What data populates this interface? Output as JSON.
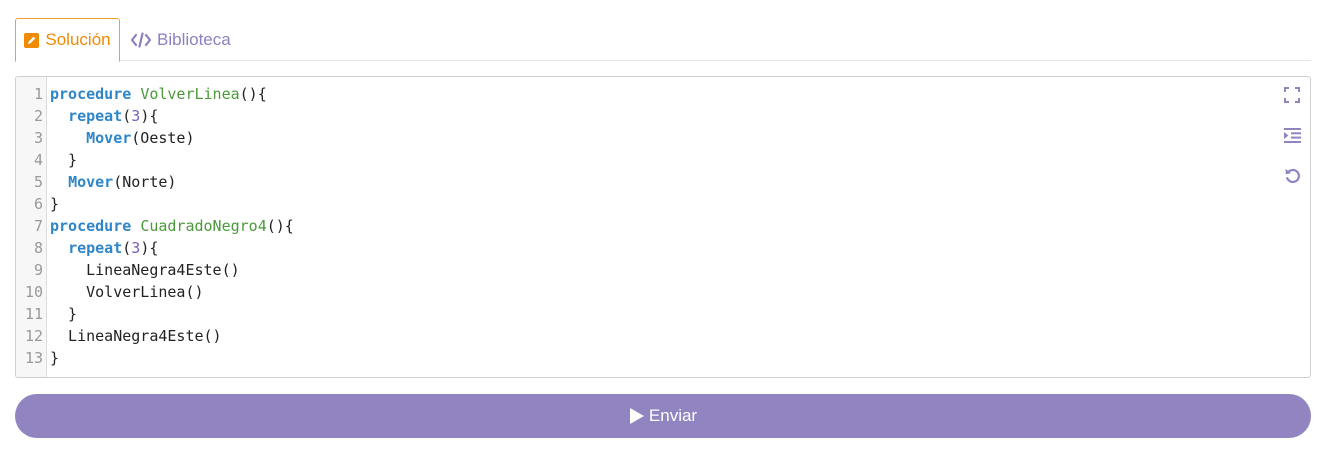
{
  "tabs": {
    "solucion_label": "Solución",
    "biblioteca_label": "Biblioteca"
  },
  "editor": {
    "lines": [
      {
        "n": "1",
        "tokens": [
          [
            "kw",
            "procedure"
          ],
          [
            "t",
            " "
          ],
          [
            "fn",
            "VolverLinea"
          ],
          [
            "t",
            "(){"
          ]
        ]
      },
      {
        "n": "2",
        "tokens": [
          [
            "t",
            "  "
          ],
          [
            "kw",
            "repeat"
          ],
          [
            "t",
            "("
          ],
          [
            "num",
            "3"
          ],
          [
            "t",
            "){"
          ]
        ]
      },
      {
        "n": "3",
        "tokens": [
          [
            "t",
            "    "
          ],
          [
            "kw",
            "Mover"
          ],
          [
            "t",
            "(Oeste)"
          ]
        ]
      },
      {
        "n": "4",
        "tokens": [
          [
            "t",
            "  }"
          ]
        ]
      },
      {
        "n": "5",
        "tokens": [
          [
            "t",
            "  "
          ],
          [
            "kw",
            "Mover"
          ],
          [
            "t",
            "(Norte)"
          ]
        ]
      },
      {
        "n": "6",
        "tokens": [
          [
            "t",
            "}"
          ]
        ]
      },
      {
        "n": "7",
        "tokens": [
          [
            "kw",
            "procedure"
          ],
          [
            "t",
            " "
          ],
          [
            "fn",
            "CuadradoNegro4"
          ],
          [
            "t",
            "(){"
          ]
        ]
      },
      {
        "n": "8",
        "tokens": [
          [
            "t",
            "  "
          ],
          [
            "kw",
            "repeat"
          ],
          [
            "t",
            "("
          ],
          [
            "num",
            "3"
          ],
          [
            "t",
            "){"
          ]
        ]
      },
      {
        "n": "9",
        "tokens": [
          [
            "t",
            "    LineaNegra4Este()"
          ]
        ]
      },
      {
        "n": "10",
        "tokens": [
          [
            "t",
            "    VolverLinea()"
          ]
        ]
      },
      {
        "n": "11",
        "tokens": [
          [
            "t",
            "  }"
          ]
        ]
      },
      {
        "n": "12",
        "tokens": [
          [
            "t",
            "  LineaNegra4Este()"
          ]
        ]
      },
      {
        "n": "13",
        "tokens": [
          [
            "t",
            "}"
          ]
        ]
      }
    ]
  },
  "submit": {
    "label": "Enviar"
  },
  "colors": {
    "accent_orange": "#f08a00",
    "accent_purple": "#9184c0",
    "keyword": "#2e86c9",
    "function_name": "#4a9a3a"
  },
  "icons": {
    "solucion": "pencil-square-icon",
    "biblioteca": "code-icon",
    "fullscreen": "fullscreen-icon",
    "indent": "indent-icon",
    "reset": "undo-icon",
    "submit": "play-icon"
  }
}
